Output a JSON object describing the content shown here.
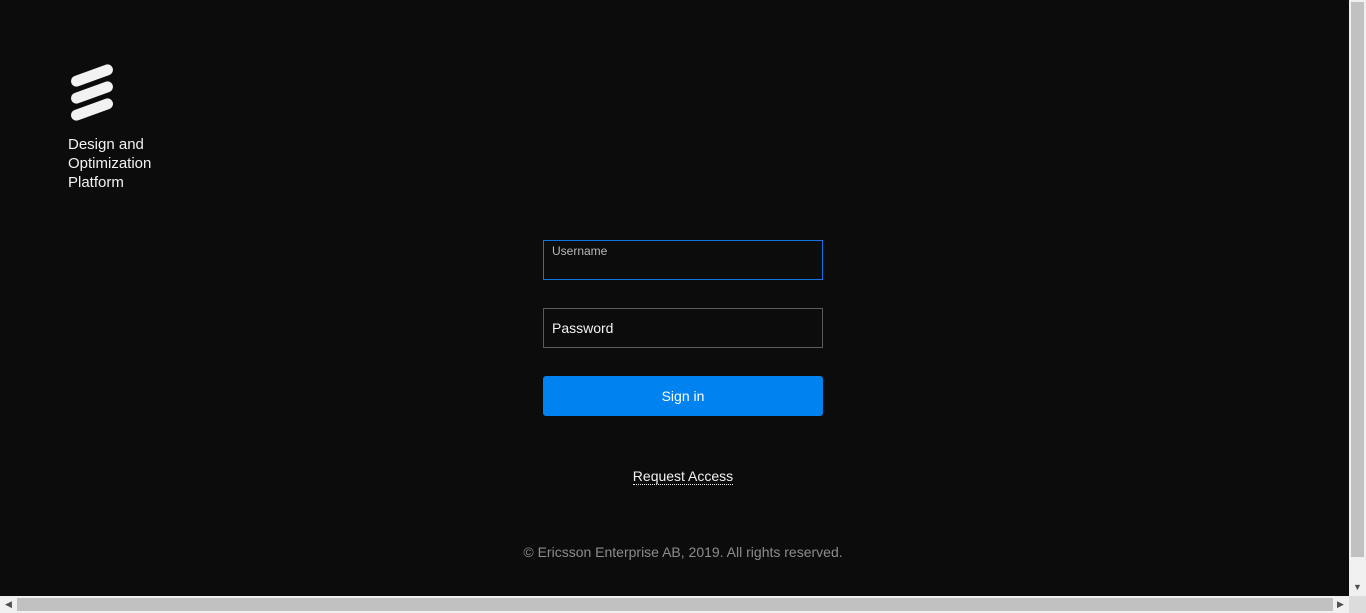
{
  "brand": {
    "logo_icon": "ericsson-logo-icon",
    "product_line1": "Design and",
    "product_line2": "Optimization",
    "product_line3": "Platform"
  },
  "login": {
    "username_label": "Username",
    "username_value": "",
    "password_placeholder": "Password",
    "password_value": "",
    "signin_label": "Sign in",
    "request_access_label": "Request Access"
  },
  "footer": {
    "copyright": "© Ericsson Enterprise AB, 2019. All rights reserved."
  },
  "colors": {
    "background": "#0c0c0c",
    "accent": "#0082f0",
    "focus_border": "#1174e6"
  },
  "scrollbars": {
    "down_arrow": "▼",
    "left_arrow": "◀",
    "right_arrow": "▶"
  }
}
